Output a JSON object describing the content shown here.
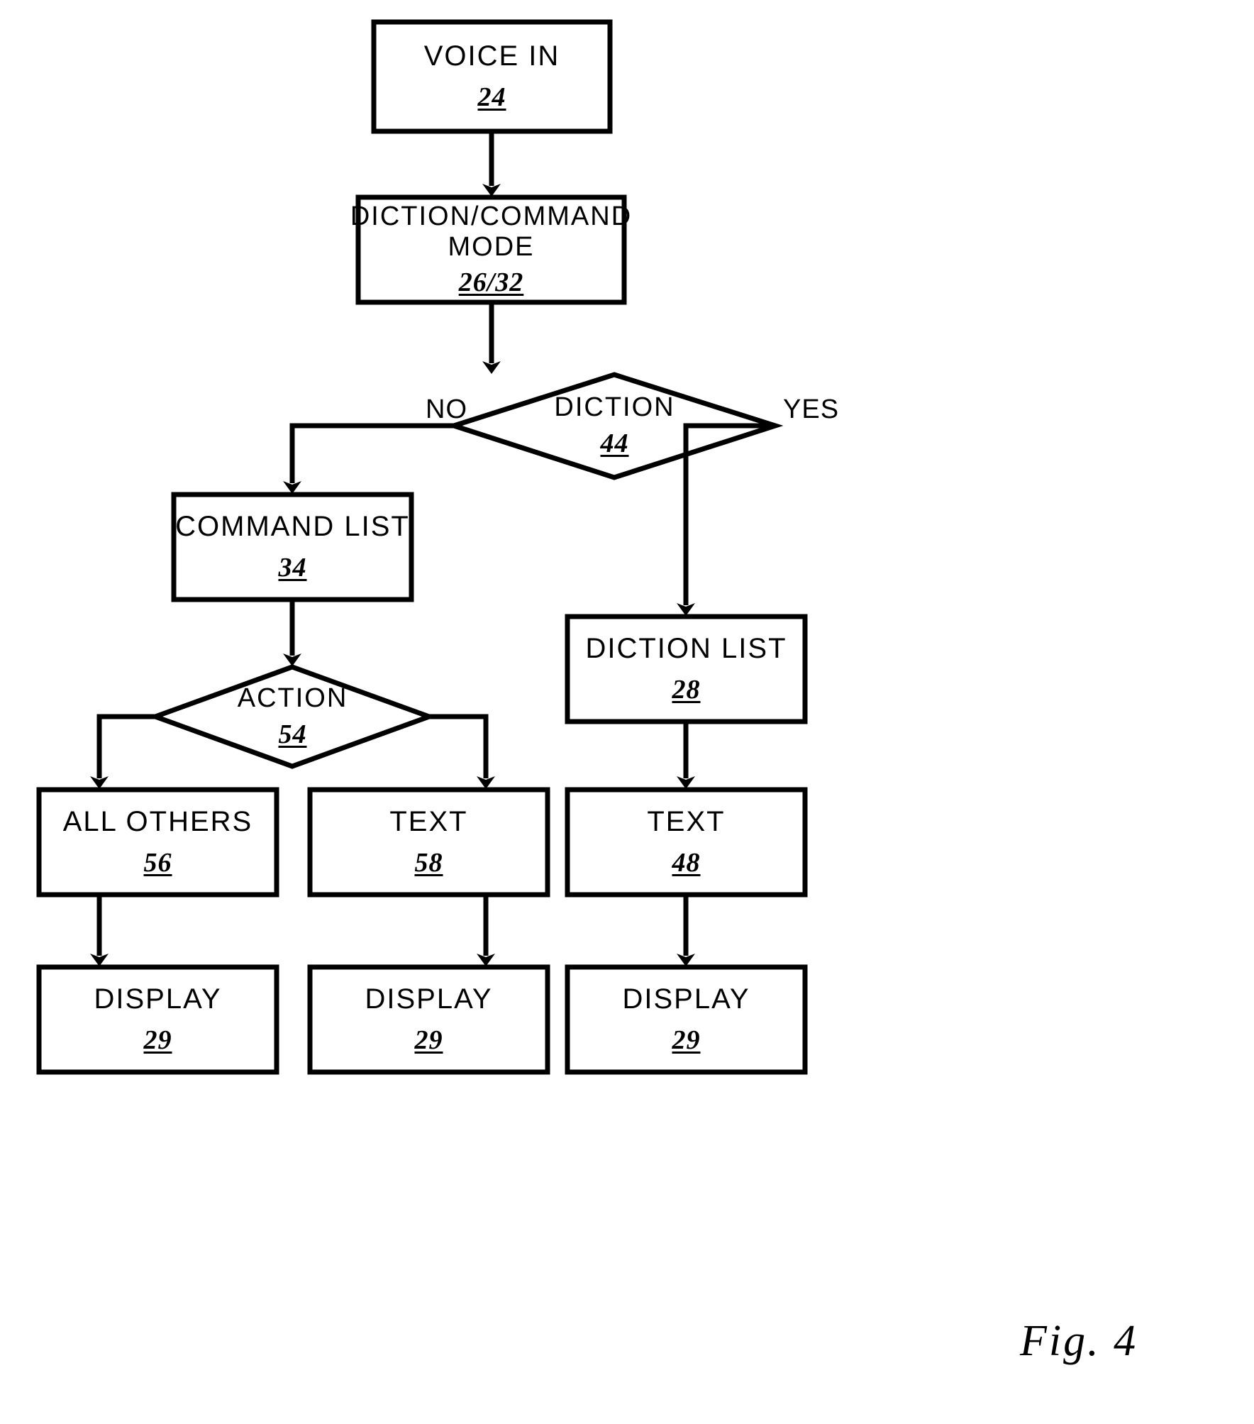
{
  "figure": {
    "caption": "Fig. 4",
    "type": "patent-flowchart"
  },
  "nodes": [
    {
      "id": "voice_in",
      "shape": "rect",
      "title": "VOICE IN",
      "ref": "24"
    },
    {
      "id": "mode",
      "shape": "rect",
      "title": "DICTION/COMMAND MODE",
      "ref": "26/32"
    },
    {
      "id": "diction_q",
      "shape": "diamond",
      "title": "DICTION",
      "ref": "44"
    },
    {
      "id": "command_list",
      "shape": "rect",
      "title": "COMMAND LIST",
      "ref": "34"
    },
    {
      "id": "diction_list",
      "shape": "rect",
      "title": "DICTION LIST",
      "ref": "28"
    },
    {
      "id": "action_q",
      "shape": "diamond",
      "title": "ACTION",
      "ref": "54"
    },
    {
      "id": "all_others",
      "shape": "rect",
      "title": "ALL OTHERS",
      "ref": "56"
    },
    {
      "id": "text_cmd",
      "shape": "rect",
      "title": "TEXT",
      "ref": "58"
    },
    {
      "id": "text_dict",
      "shape": "rect",
      "title": "TEXT",
      "ref": "48"
    },
    {
      "id": "display_left",
      "shape": "rect",
      "title": "DISPLAY",
      "ref": "29"
    },
    {
      "id": "display_mid",
      "shape": "rect",
      "title": "DISPLAY",
      "ref": "29"
    },
    {
      "id": "display_right",
      "shape": "rect",
      "title": "DISPLAY",
      "ref": "29"
    }
  ],
  "edge_labels": {
    "no": "NO",
    "yes": "YES"
  },
  "colors": {
    "stroke": "#000000",
    "fill": "#ffffff",
    "text": "#000000"
  }
}
